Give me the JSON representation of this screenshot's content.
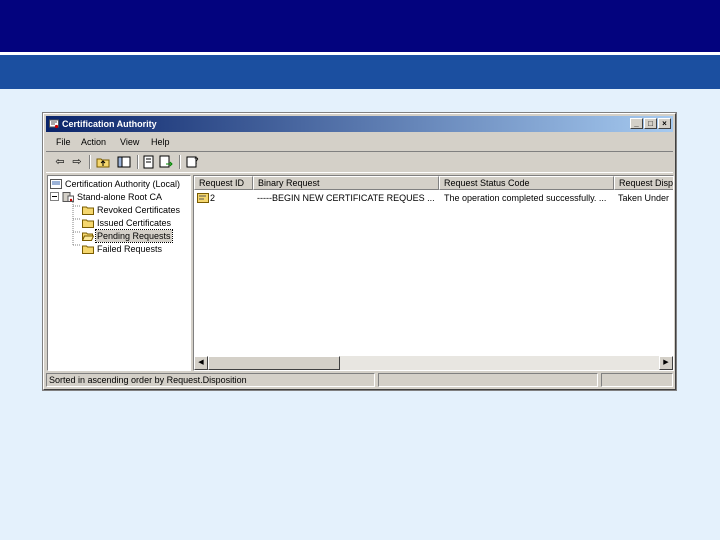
{
  "window": {
    "title": "Certification Authority",
    "controls": {
      "minimize": "_",
      "maximize": "□",
      "close": "×"
    }
  },
  "menu": [
    {
      "label": "File"
    },
    {
      "label": "Action"
    },
    {
      "label": "View"
    },
    {
      "label": "Help"
    }
  ],
  "toolbar": {
    "icons": [
      "back-icon",
      "forward-icon",
      "up-folder-icon",
      "show-hide-tree-icon",
      "properties-icon",
      "export-list-icon",
      "help-icon"
    ]
  },
  "tree": {
    "root": "Certification Authority (Local)",
    "ca": "Stand-alone Root CA",
    "items": [
      {
        "label": "Revoked Certificates"
      },
      {
        "label": "Issued Certificates"
      },
      {
        "label": "Pending Requests",
        "selected": true
      },
      {
        "label": "Failed Requests"
      }
    ]
  },
  "list": {
    "columns": [
      "Request ID",
      "Binary Request",
      "Request Status Code",
      "Request Disp"
    ],
    "rows": [
      {
        "id": "2",
        "binary": "-----BEGIN NEW CERTIFICATE REQUES ...",
        "status": "The operation completed successfully. ...",
        "disposition": "Taken Under"
      }
    ]
  },
  "statusbar": {
    "text": "Sorted in ascending order by Request.Disposition"
  },
  "colors": {
    "slide_top": "#03037e",
    "slide_band": "#1b4fa0",
    "background": "#e4f1fc",
    "titlebar_start": "#0a246a",
    "titlebar_end": "#a6caf0",
    "chrome": "#d4d0c8"
  }
}
